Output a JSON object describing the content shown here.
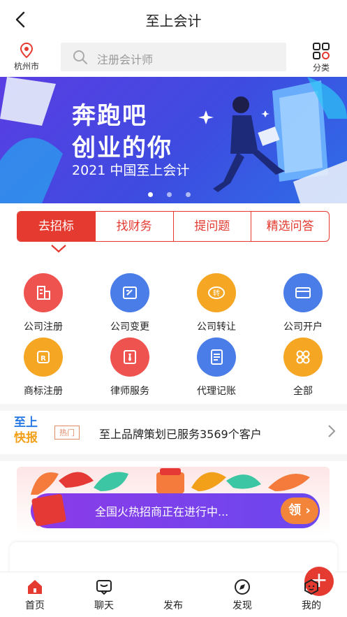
{
  "header": {
    "title": "至上会计"
  },
  "location": {
    "city": "杭州市"
  },
  "search": {
    "placeholder": "注册会计师"
  },
  "classify": {
    "label": "分类"
  },
  "banner": {
    "line1": "奔跑吧",
    "line2": "创业的你",
    "line3": "2021 中国至上会计",
    "background": "#4a45e4"
  },
  "tabs": [
    "去招标",
    "找财务",
    "提问题",
    "精选问答"
  ],
  "services": [
    {
      "label": "公司注册",
      "icon": "building-icon",
      "color": "#ef5350"
    },
    {
      "label": "公司变更",
      "icon": "edit-card-icon",
      "color": "#4a7de8"
    },
    {
      "label": "公司转让",
      "icon": "transfer-icon",
      "color": "#f5a623"
    },
    {
      "label": "公司开户",
      "icon": "bank-card-icon",
      "color": "#4a7de8"
    },
    {
      "label": "商标注册",
      "icon": "trademark-icon",
      "color": "#f5a623"
    },
    {
      "label": "律师服务",
      "icon": "tie-icon",
      "color": "#ef5350"
    },
    {
      "label": "代理记账",
      "icon": "ledger-icon",
      "color": "#4a7de8"
    },
    {
      "label": "全部",
      "icon": "grid-icon",
      "color": "#f5a623"
    }
  ],
  "news": {
    "logo_top": "至上",
    "logo_bottom": "快报",
    "badge": "热门",
    "text": "至上品牌策划已服务3569个客户"
  },
  "promo": {
    "text": "全国火热招商正在进行中...",
    "button": "领"
  },
  "bottom_nav": [
    {
      "label": "首页",
      "icon": "home-icon"
    },
    {
      "label": "聊天",
      "icon": "chat-icon"
    },
    {
      "label": "发布",
      "icon": "plus-icon"
    },
    {
      "label": "发现",
      "icon": "compass-icon"
    },
    {
      "label": "我的",
      "icon": "profile-icon"
    }
  ],
  "accent": "#e43a2f"
}
